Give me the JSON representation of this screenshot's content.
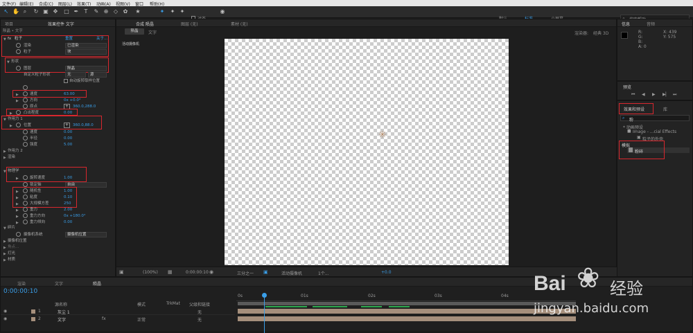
{
  "menu": [
    "文件(F)",
    "编辑(E)",
    "合成(C)",
    "图层(L)",
    "效果(T)",
    "动画(A)",
    "视图(V)",
    "窗口",
    "帮助(H)"
  ],
  "toolbar": {
    "align_label": "对齐",
    "workspaces": [
      "默认",
      "标准",
      "小屏幕"
    ],
    "search_placeholder": "搜索帮助"
  },
  "left_panel": {
    "tabs": [
      "项目",
      "效果控件 文字"
    ],
    "breadcrumb": "陨晶 • 文字",
    "effect_header": {
      "name": "粒子",
      "reset": "重置",
      "about": "关于..."
    },
    "rows": [
      {
        "label": "渲染",
        "value": "已渲染"
      },
      {
        "label": "粒子",
        "value": "块"
      },
      {
        "label": "形状",
        "value": ""
      },
      {
        "label": "图层",
        "value": "陨晶"
      },
      {
        "label": "自定义粒子形状",
        "value": "无",
        "value2": "源"
      },
      {
        "label": "",
        "value": "自动旋转取样位置"
      },
      {
        "label": "速度",
        "value": "63.00"
      },
      {
        "label": "方向",
        "value": "0x +0.0°"
      },
      {
        "label": "原点",
        "value": "360.0,288.0"
      },
      {
        "label": "凸出程度",
        "value": "0.00"
      },
      {
        "label": "作用力 1",
        "value": ""
      },
      {
        "label": "位置",
        "value": "360.0,88.0"
      },
      {
        "label": "速度",
        "value": "0.00"
      },
      {
        "label": "半径",
        "value": "0.00"
      },
      {
        "label": "强度",
        "value": "5.00"
      },
      {
        "label": "作用力 2",
        "value": ""
      },
      {
        "label": "渲染",
        "value": ""
      },
      {
        "label": "物理学",
        "value": ""
      },
      {
        "label": "旋转速度",
        "value": "1.00"
      },
      {
        "label": "锁定轴",
        "value": "自由"
      },
      {
        "label": "随机性",
        "value": "1.00"
      },
      {
        "label": "粘度",
        "value": "0.10"
      },
      {
        "label": "大规模方差",
        "value": "250"
      },
      {
        "label": "重力",
        "value": "2.00"
      },
      {
        "label": "重力方向",
        "value": "0x +180.0°"
      },
      {
        "label": "重力倾向",
        "value": "0.00"
      },
      {
        "label": "碎片",
        "value": ""
      },
      {
        "label": "摄像机系统",
        "value": "摄像机位置"
      },
      {
        "label": "摄像机位置",
        "value": ""
      },
      {
        "label": "灯光",
        "value": ""
      },
      {
        "label": "灯光",
        "value": ""
      },
      {
        "label": "材质",
        "value": ""
      }
    ]
  },
  "comp": {
    "tabs": [
      "合成 陨晶",
      "图层 (无)",
      "素材 (无)"
    ],
    "subtabs": [
      "陨晶",
      "文字"
    ],
    "camera_label": "活动摄像机",
    "renderer_label": "渲染器:",
    "renderer_value": "经典 3D",
    "footer": {
      "zoom": "(100%)",
      "time": "0:00:00:10",
      "resolution": "三分之一",
      "view": "活动摄像机",
      "views": "1个...",
      "exposure": "+0.0"
    }
  },
  "info_panel": {
    "tabs": [
      "信息",
      "音频"
    ],
    "r": "R:",
    "g": "G:",
    "b": "B:",
    "a": "A: 0",
    "x": "X: 439",
    "y": "Y: 575"
  },
  "preview_panel": {
    "title": "预览"
  },
  "effects_panel": {
    "tabs": [
      "效果和预设",
      "库"
    ],
    "search_value": "粉",
    "tree": [
      "* 动画预设",
      "Image - ...cial Effects",
      "粒子的外壳",
      "模拟",
      "粉碎"
    ]
  },
  "timeline": {
    "tabs": [
      "渲染",
      "文字",
      "陨晶"
    ],
    "timecode": "0:00:00:10",
    "columns": {
      "name": "源名称",
      "mode": "模式",
      "trkmat": "TrkMat",
      "parent": "父级和链接"
    },
    "layers": [
      {
        "num": "1",
        "name": "灰尘 1",
        "mode": "",
        "parent": "无"
      },
      {
        "num": "2",
        "name": "文字",
        "mode": "正常",
        "parent": "无"
      }
    ],
    "ruler": [
      "0s",
      "01s",
      "02s",
      "03s",
      "04s"
    ]
  },
  "watermark": {
    "brand": "Bai",
    "brand2": "经验",
    "url": "jingyan.baidu.com"
  }
}
